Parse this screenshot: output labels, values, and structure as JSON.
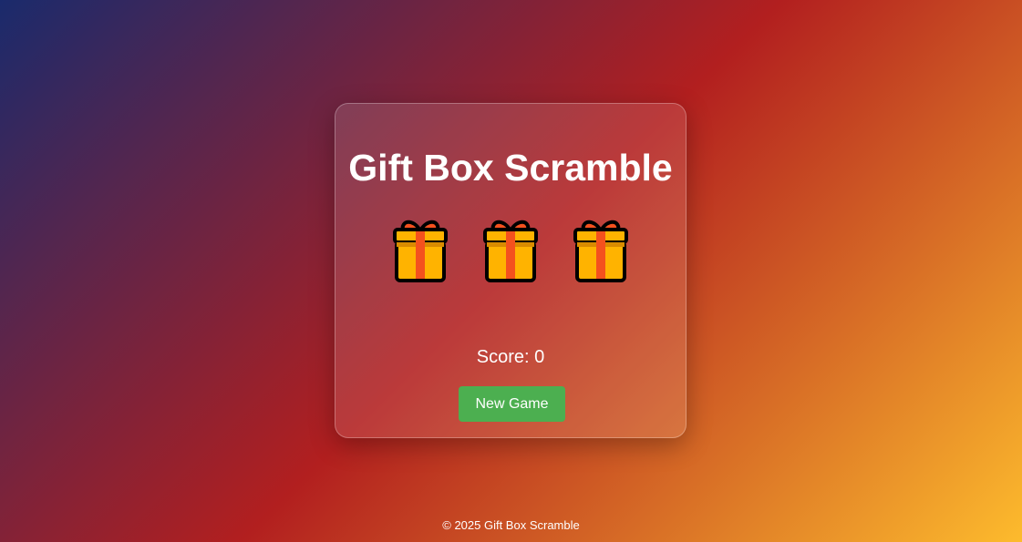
{
  "game": {
    "title": "Gift Box Scramble",
    "gift_count": 3,
    "score_label": "Score: 0",
    "new_game_label": "New Game"
  },
  "footer": {
    "copyright": "© 2025 Gift Box Scramble"
  },
  "icons": {
    "gift": "gift-icon"
  },
  "colors": {
    "gradient_start": "#1a2a6c",
    "gradient_mid": "#b21f1f",
    "gradient_end": "#fdbb2d",
    "button": "#4caf50",
    "gift_body": "#ffb300",
    "gift_ribbon": "#f4511e"
  }
}
